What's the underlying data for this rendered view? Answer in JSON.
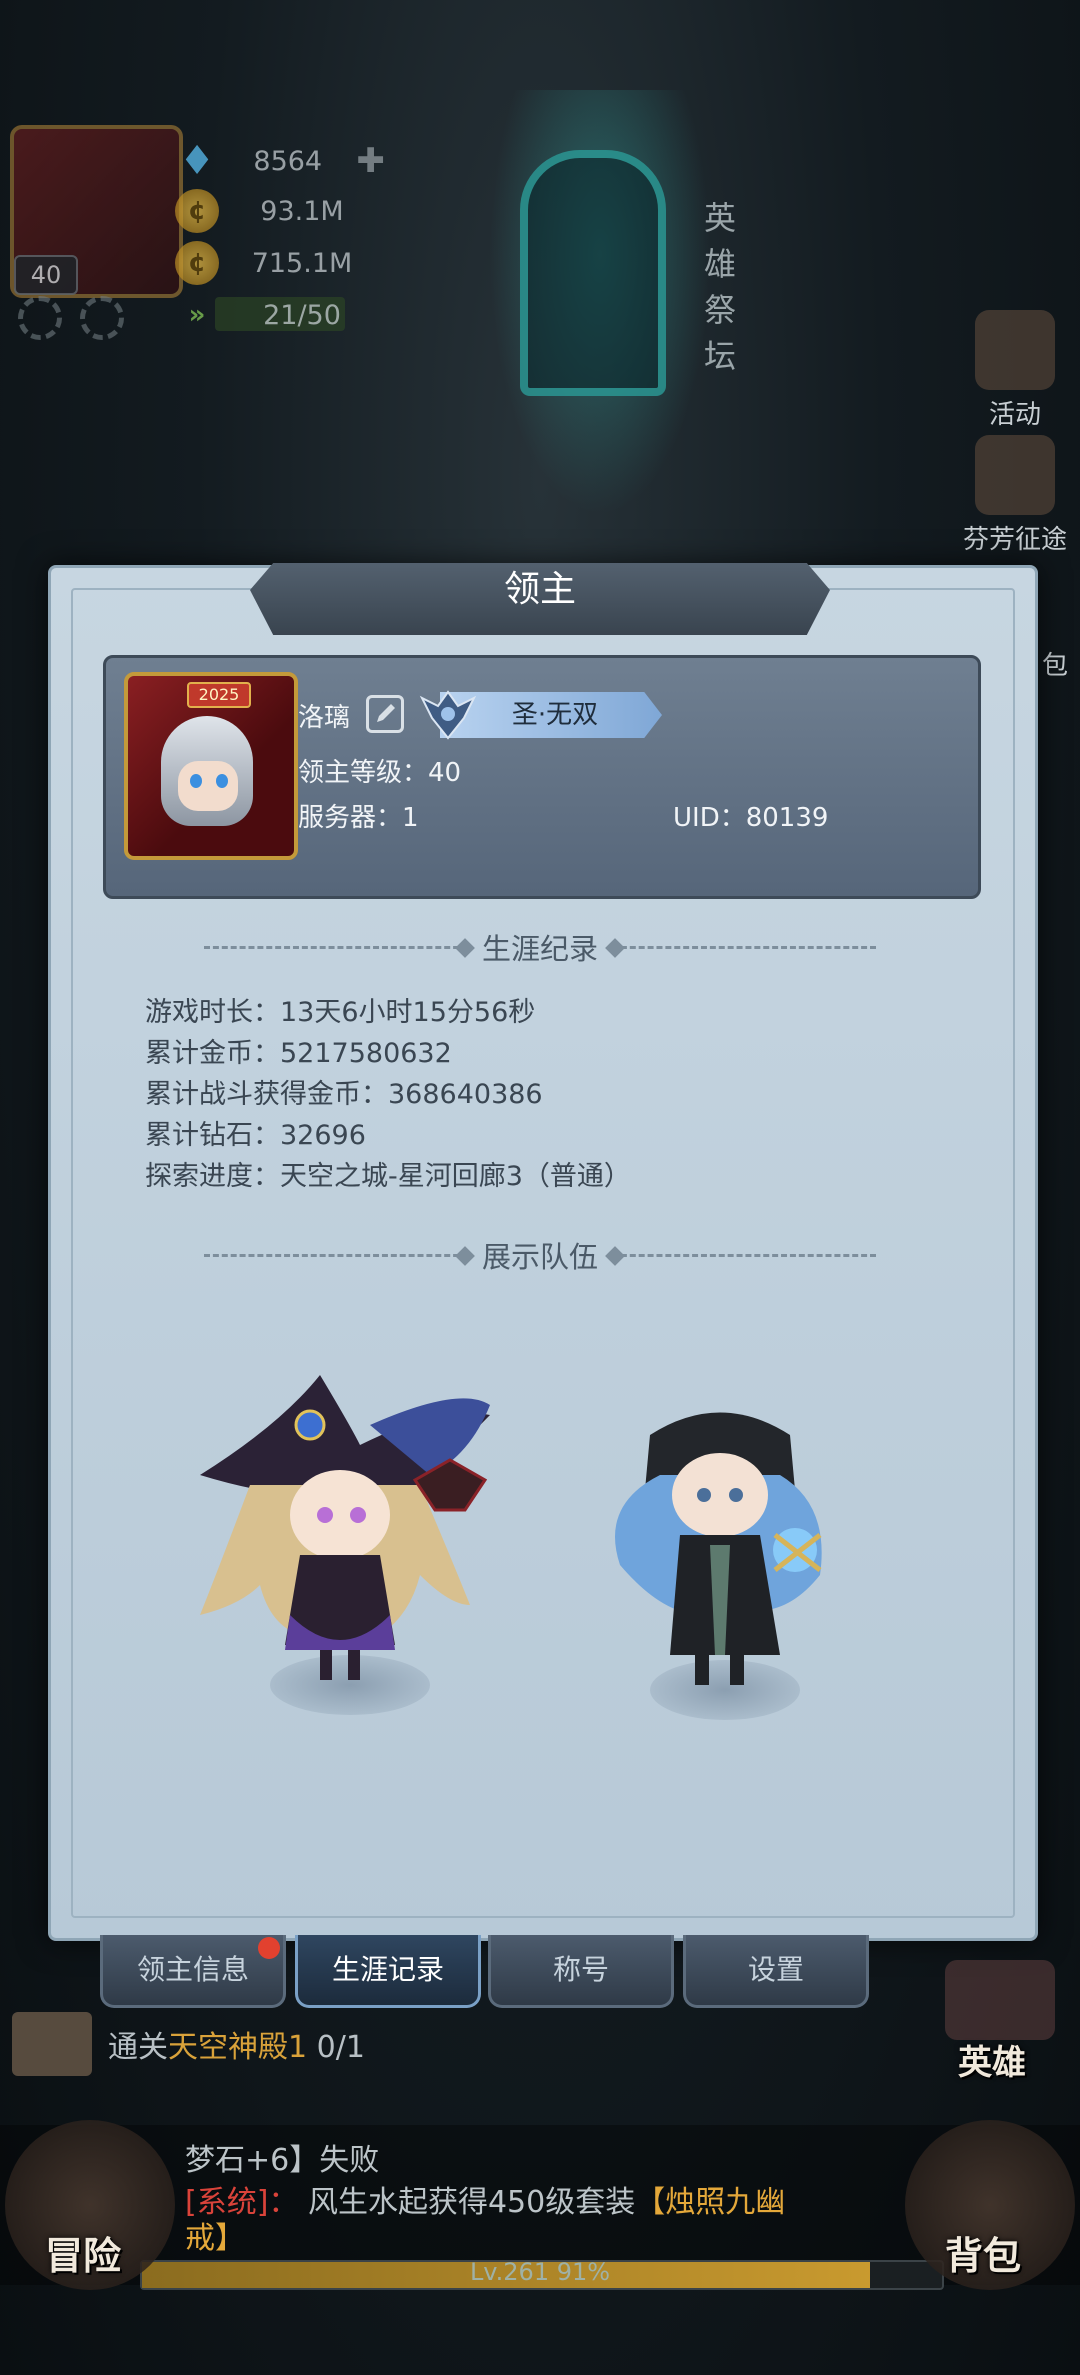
{
  "hud": {
    "avatar_year": "2025",
    "level": "40",
    "diamonds": "8564",
    "gold1": "93.1M",
    "gold2": "715.1M",
    "energy": "21/50",
    "energy_fraction": 0.42,
    "altar_label": "英雄祭坛",
    "side_buttons": [
      "活动",
      "芬芳征途",
      "包"
    ],
    "hero_button": "英雄"
  },
  "dialog": {
    "title": "领主",
    "lord": {
      "name": "洛璃",
      "title_badge": "圣·无双",
      "avatar_year": "2025",
      "level_line": "领主等级：40",
      "server_line": "服务器：1",
      "uid_line": "UID：80139"
    },
    "career": {
      "header": "生涯纪录",
      "lines": [
        "游戏时长：13天6小时15分56秒",
        "累计金币：5217580632",
        "累计战斗获得金币：368640386",
        "累计钻石：32696",
        "探索进度：天空之城-星河回廊3（普通）"
      ]
    },
    "team": {
      "header": "展示队伍"
    },
    "tabs": [
      "领主信息",
      "生涯记录",
      "称号",
      "设置"
    ],
    "active_tab": 1
  },
  "bottom": {
    "quest_prefix": "通关",
    "quest_target": "天空神殿1",
    "quest_progress": "0/1",
    "chat_line1": "梦石+6】失败",
    "chat_sys": "[系统]：",
    "chat_line2_a": "风生水起获得450级套装",
    "chat_line2_b": "【烛照九幽",
    "chat_line3": "戒】",
    "adventure_label": "冒险",
    "bag_label": "背包",
    "exp_text": "Lv.261  91%",
    "exp_fraction": 0.91
  },
  "colors": {
    "accent_gold": "#d9a23a",
    "system_red": "#d9433a",
    "panel_blue": "#b7c9d7"
  }
}
